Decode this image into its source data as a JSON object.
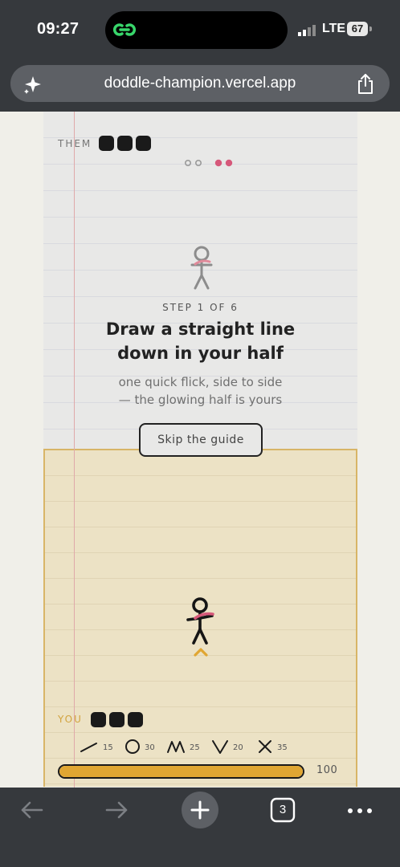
{
  "status": {
    "time": "09:27",
    "network": "LTE",
    "battery": "67"
  },
  "browser": {
    "url": "doddle-champion.vercel.app",
    "tab_count": "3"
  },
  "game": {
    "opponent_label": "THEM",
    "player_label": "YOU",
    "opponent_lives": 3,
    "player_lives": 3,
    "step_label": "STEP 1 OF 6",
    "instruction_line1": "Draw a straight line",
    "instruction_line2": "down in your half",
    "subtext_line1": "one quick flick, side to side",
    "subtext_line2": "— the glowing half is yours",
    "skip_label": "Skip the guide",
    "legend": [
      {
        "icon": "line-stroke-icon",
        "cost": "15"
      },
      {
        "icon": "circle-stroke-icon",
        "cost": "30"
      },
      {
        "icon": "zigzag-stroke-icon",
        "cost": "25"
      },
      {
        "icon": "v-stroke-icon",
        "cost": "20"
      },
      {
        "icon": "x-stroke-icon",
        "cost": "35"
      }
    ],
    "ink_value": "100",
    "ink_fraction": 1.0
  },
  "colors": {
    "accent": "#e0a632",
    "you_half": "#ece2c5",
    "them_half": "#e8e8e7",
    "rose": "#d6587a"
  }
}
